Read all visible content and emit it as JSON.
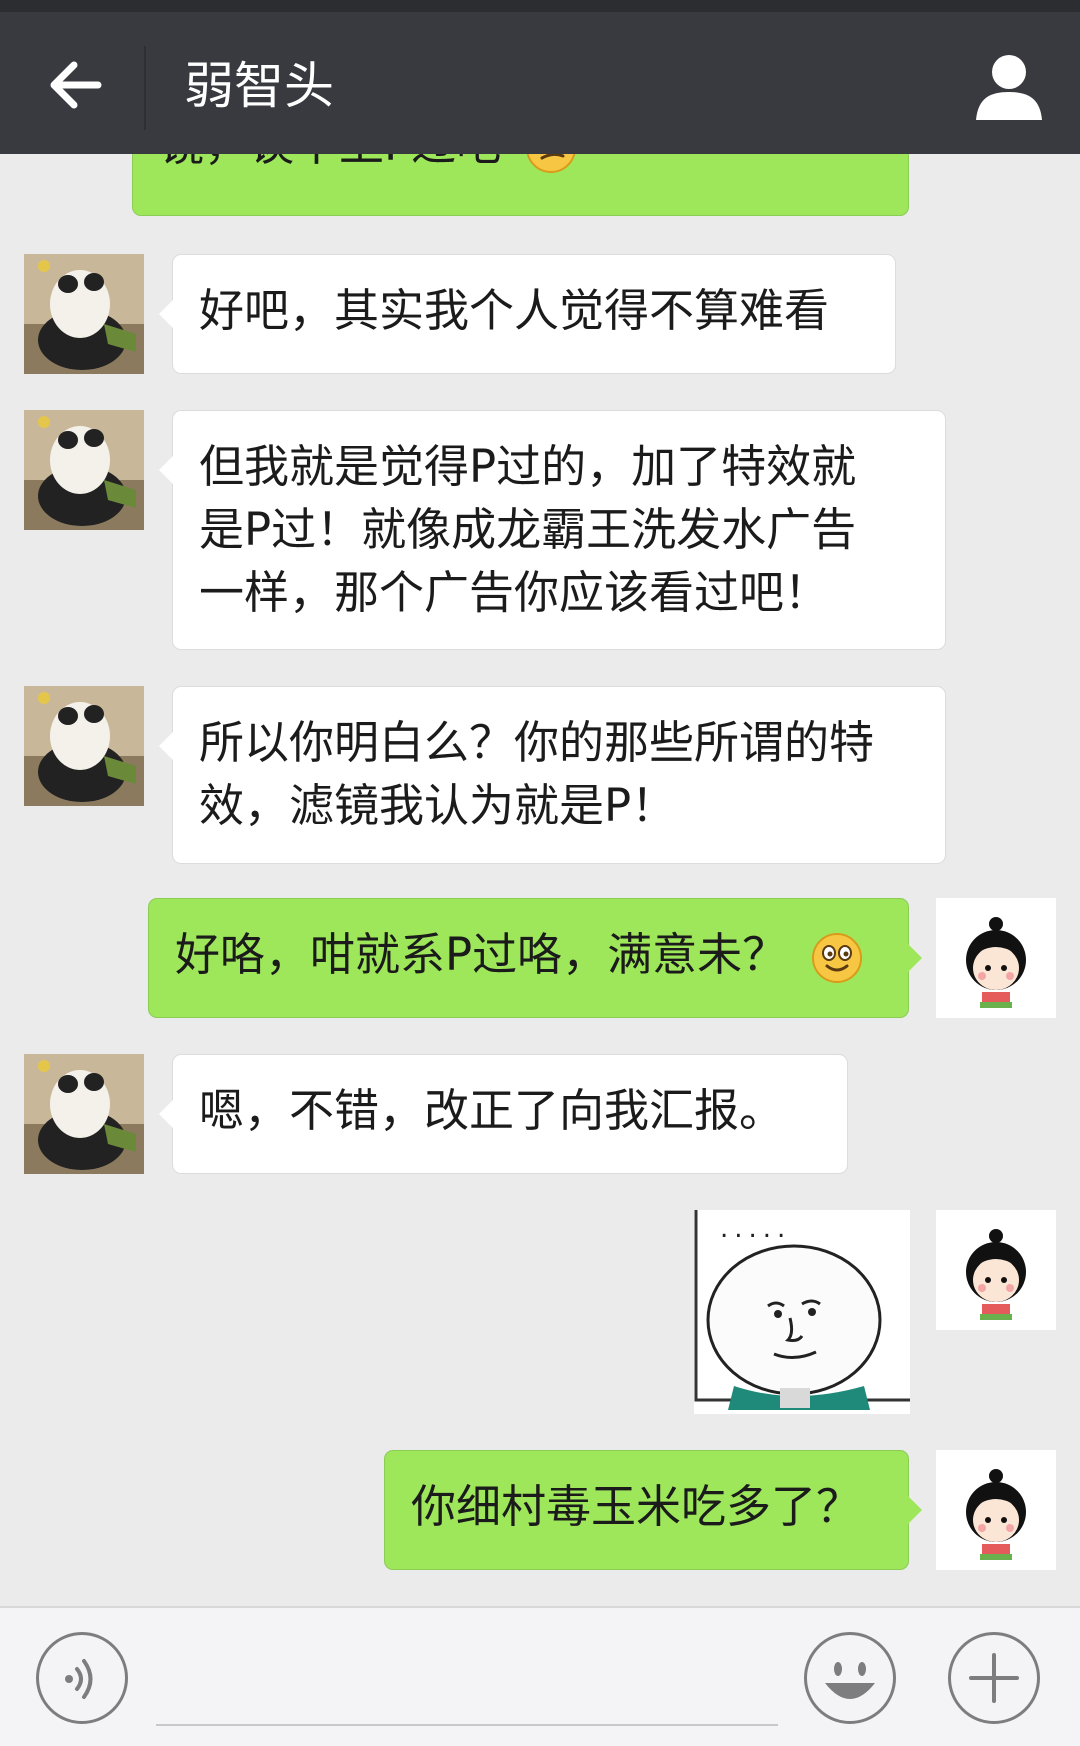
{
  "header": {
    "title": "弱智头"
  },
  "messages": [
    {
      "side": "right",
      "text_visible": "镜，谈不上P过吧",
      "emoji": "smirk-emoji",
      "partially_hidden": true
    },
    {
      "side": "left",
      "text": "好吧，其实我个人觉得不算难看",
      "avatar": "panda-avatar"
    },
    {
      "side": "left",
      "lines": [
        "但我就是觉得P过的，加了特效就",
        "是P过！就像成龙霸王洗发水广告",
        "一样，那个广告你应该看过吧！"
      ],
      "avatar": "panda-avatar"
    },
    {
      "side": "left",
      "lines": [
        "所以你明白么？你的那些所谓的特",
        "效，滤镜我认为就是P！"
      ],
      "avatar": "panda-avatar"
    },
    {
      "side": "right",
      "text": "好咯，咁就系P过咯，满意未？",
      "emoji": "smile-emoji",
      "avatar": "girl-avatar"
    },
    {
      "side": "left",
      "text": "嗯，不错，改正了向我汇报。",
      "avatar": "panda-avatar"
    },
    {
      "side": "right",
      "type": "sticker",
      "sticker": "meme-face-sticker",
      "sticker_text": ".....",
      "avatar": "girl-avatar"
    },
    {
      "side": "right",
      "text": "你细村毒玉米吃多了？",
      "avatar": "girl-avatar"
    }
  ],
  "colors": {
    "header_bg": "#393a3f",
    "chat_bg": "#ebebeb",
    "bubble_right": "#9ee75b",
    "bubble_left": "#ffffff",
    "bottom_bar_bg": "#f4f4f6"
  },
  "icons": {
    "back": "arrow-left-icon",
    "profile": "person-icon",
    "voice": "voice-icon",
    "emoji": "emoji-icon",
    "plus": "plus-icon"
  }
}
